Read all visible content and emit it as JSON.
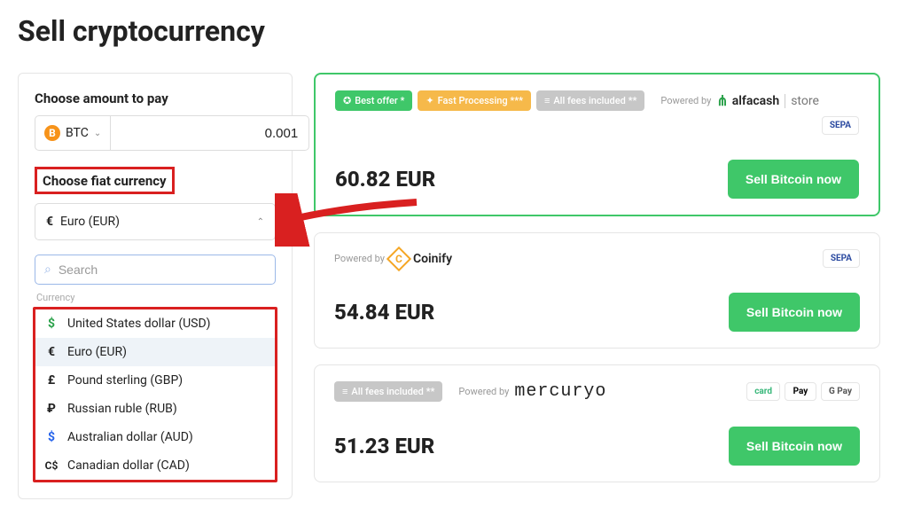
{
  "page_title": "Sell cryptocurrency",
  "left": {
    "amount_label": "Choose amount to pay",
    "crypto_symbol": "BTC",
    "crypto_icon_char": "B",
    "amount_value": "0.001",
    "fiat_label": "Choose fiat currency",
    "fiat_selected": "Euro (EUR)",
    "fiat_selected_sym": "€",
    "search_placeholder": "Search",
    "list_heading": "Currency",
    "currencies": [
      {
        "sym": "$",
        "class": "usd-sym",
        "name": "United States dollar (USD)"
      },
      {
        "sym": "€",
        "class": "eur-c",
        "name": "Euro (EUR)"
      },
      {
        "sym": "£",
        "class": "gbp-sym",
        "name": "Pound sterling (GBP)"
      },
      {
        "sym": "₽",
        "class": "rub-sym",
        "name": "Russian ruble (RUB)"
      },
      {
        "sym": "$",
        "class": "aud-sym",
        "name": "Australian dollar (AUD)"
      },
      {
        "sym": "C$",
        "class": "cad-sym",
        "name": "Canadian dollar (CAD)"
      }
    ]
  },
  "offers": [
    {
      "best": true,
      "badges": [
        {
          "cls": "green",
          "icon": "✪",
          "text": "Best offer *"
        },
        {
          "cls": "orange",
          "icon": "✦",
          "text": "Fast Processing ***"
        },
        {
          "cls": "grey",
          "icon": "≡",
          "text": "All fees included **"
        }
      ],
      "powered_by": "Powered by",
      "brand": "alfacash",
      "price": "60.82 EUR",
      "pay_chips": [
        "SEPA"
      ],
      "cta": "Sell Bitcoin now"
    },
    {
      "best": false,
      "badges": [],
      "powered_by": "Powered by",
      "brand": "coinify",
      "price": "54.84 EUR",
      "pay_chips": [
        "SEPA"
      ],
      "cta": "Sell Bitcoin now"
    },
    {
      "best": false,
      "badges": [
        {
          "cls": "grey",
          "icon": "≡",
          "text": "All fees included **"
        }
      ],
      "powered_by": "Powered by",
      "brand": "mercuryo",
      "price": "51.23 EUR",
      "pay_chips": [
        "card",
        "Pay",
        "G Pay"
      ],
      "cta": "Sell Bitcoin now"
    }
  ]
}
